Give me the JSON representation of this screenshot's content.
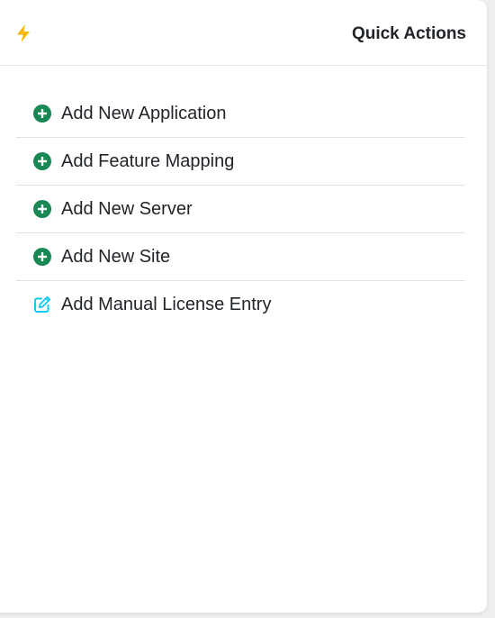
{
  "header": {
    "title": "Quick Actions",
    "icon": "lightning-icon",
    "icon_color": "#f5b800"
  },
  "actions": [
    {
      "label": "Add New Application",
      "icon": "plus-circle-icon",
      "color": "#198754"
    },
    {
      "label": "Add Feature Mapping",
      "icon": "plus-circle-icon",
      "color": "#198754"
    },
    {
      "label": "Add New Server",
      "icon": "plus-circle-icon",
      "color": "#198754"
    },
    {
      "label": "Add New Site",
      "icon": "plus-circle-icon",
      "color": "#198754"
    },
    {
      "label": "Add Manual License Entry",
      "icon": "edit-icon",
      "color": "#0dcaf0"
    }
  ]
}
